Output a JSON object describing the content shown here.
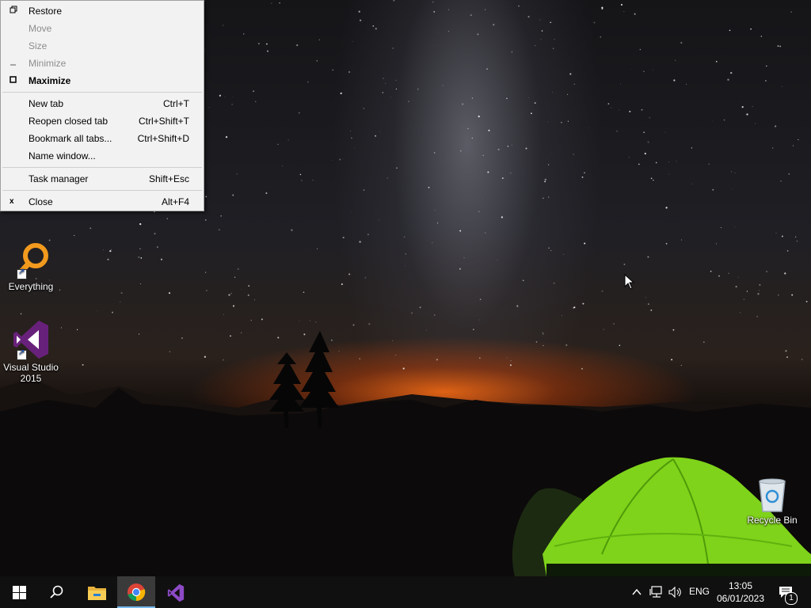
{
  "context_menu": {
    "items": [
      {
        "label": "Restore",
        "accel": "",
        "icon": "restore-icon",
        "state": "enabled"
      },
      {
        "label": "Move",
        "accel": "",
        "icon": "",
        "state": "disabled"
      },
      {
        "label": "Size",
        "accel": "",
        "icon": "",
        "state": "disabled"
      },
      {
        "label": "Minimize",
        "accel": "",
        "icon": "minimize-icon",
        "state": "disabled"
      },
      {
        "label": "Maximize",
        "accel": "",
        "icon": "maximize-icon",
        "state": "default"
      },
      {
        "label": "New tab",
        "accel": "Ctrl+T"
      },
      {
        "label": "Reopen closed tab",
        "accel": "Ctrl+Shift+T"
      },
      {
        "label": "Bookmark all tabs...",
        "accel": "Ctrl+Shift+D"
      },
      {
        "label": "Name window...",
        "accel": ""
      },
      {
        "label": "Task manager",
        "accel": "Shift+Esc"
      },
      {
        "label": "Close",
        "accel": "Alt+F4",
        "icon": "close-icon"
      }
    ]
  },
  "desktop_icons": [
    {
      "label": "Everything",
      "icon": "everything-icon"
    },
    {
      "label_line1": "Visual Studio",
      "label_line2": "2015",
      "icon": "visual-studio-icon"
    },
    {
      "label": "Recycle Bin",
      "icon": "recycle-bin-icon"
    }
  ],
  "taskbar": {
    "apps": [
      "start-icon",
      "search-icon",
      "file-explorer-icon",
      "chrome-icon",
      "visual-studio-icon"
    ],
    "active_app": "chrome",
    "language": "ENG",
    "time": "13:05",
    "date": "06/01/2023",
    "notification_count": "1"
  },
  "colors": {
    "taskbar": "#101010",
    "menu_bg": "#f2f2f2",
    "active_indicator": "#76b9ed",
    "vs_purple": "#68217a",
    "tent_green": "#7fd31a"
  }
}
